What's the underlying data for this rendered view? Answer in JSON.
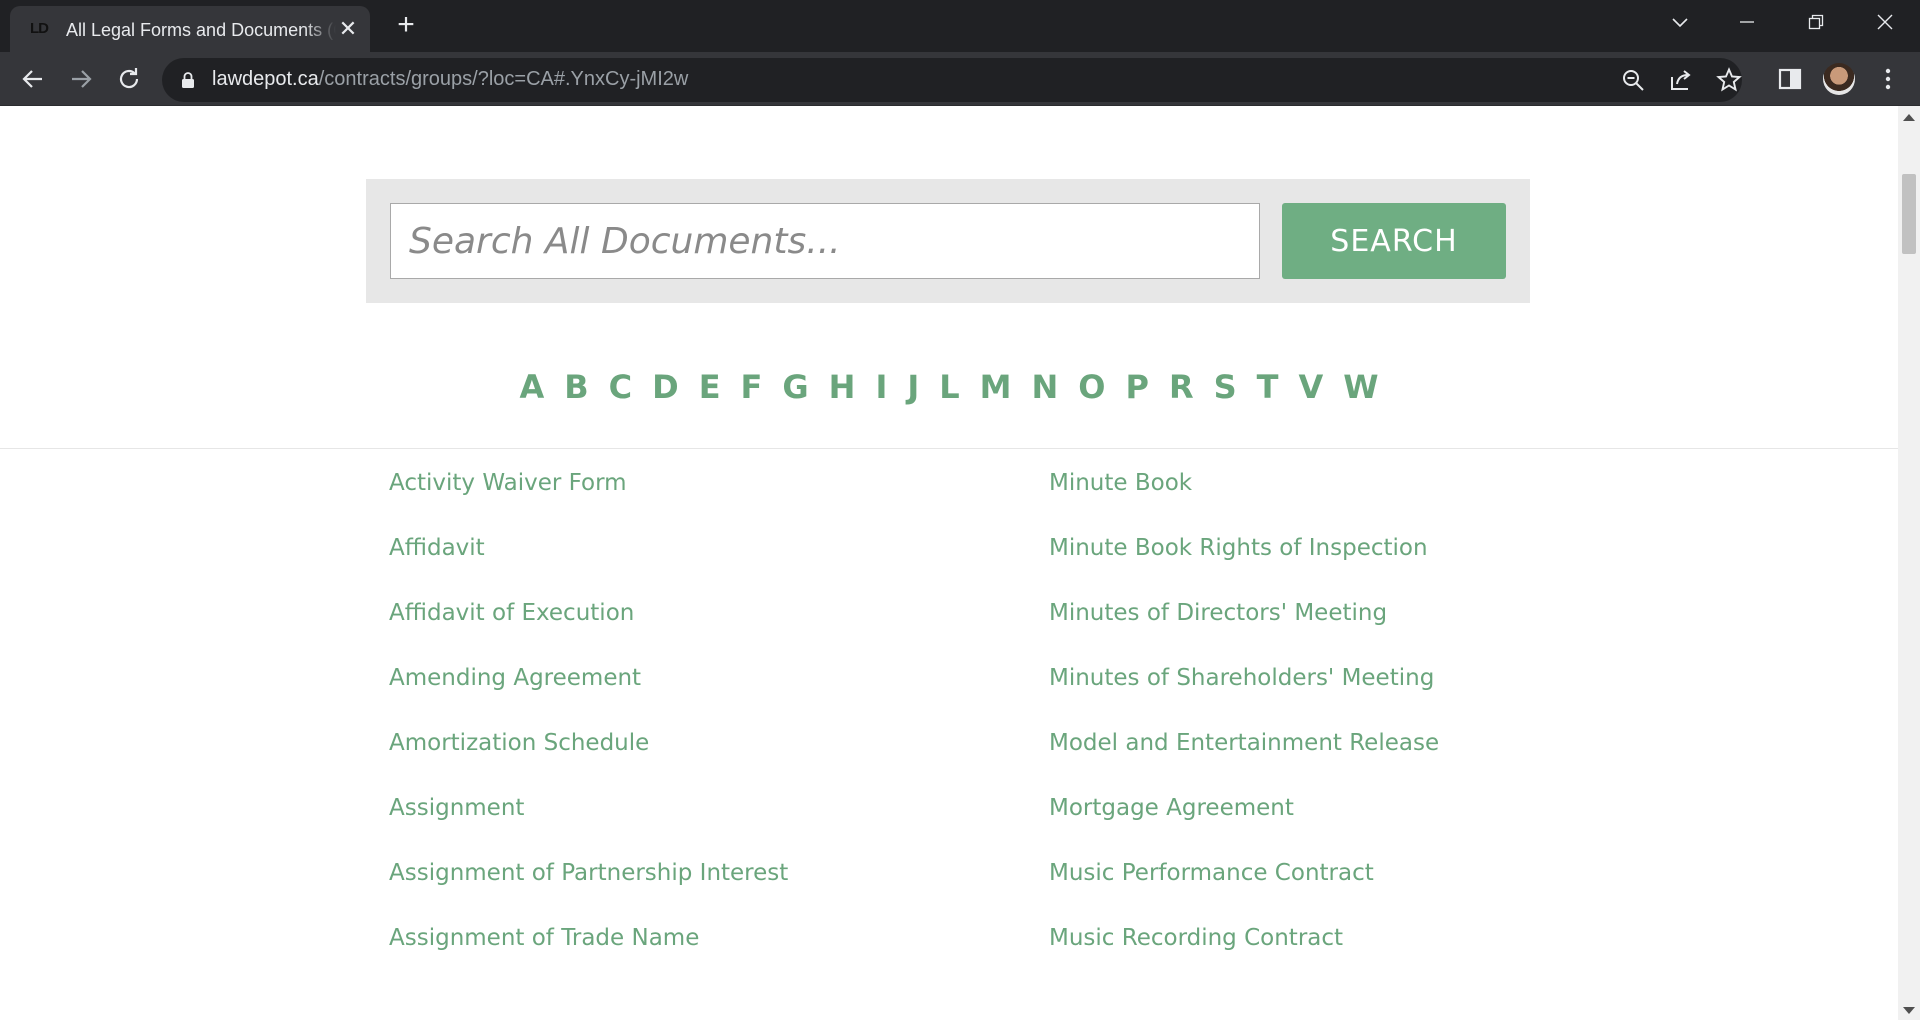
{
  "browser": {
    "tab_title": "All Legal Forms and Documents (Canada) | LawDepot",
    "favicon_text": "LD",
    "url_host": "lawdepot.ca",
    "url_path": "/contracts/groups/?loc=CA#.YnxCy-jMI2w",
    "tab_close_glyph": "✕",
    "new_tab_glyph": "+",
    "window_buttons": {
      "tab_list": "⌄",
      "minimize": "—",
      "restore": "❐",
      "close": "✕"
    }
  },
  "search": {
    "placeholder": "Search All Documents...",
    "button_label": "SEARCH"
  },
  "alphabet": [
    "A",
    "B",
    "C",
    "D",
    "E",
    "F",
    "G",
    "H",
    "I",
    "J",
    "L",
    "M",
    "N",
    "O",
    "P",
    "R",
    "S",
    "T",
    "V",
    "W"
  ],
  "documents": {
    "left": [
      "Activity Waiver Form",
      "Affidavit",
      "Affidavit of Execution",
      "Amending Agreement",
      "Amortization Schedule",
      "Assignment",
      "Assignment of Partnership Interest",
      "Assignment of Trade Name"
    ],
    "right": [
      "Minute Book",
      "Minute Book Rights of Inspection",
      "Minutes of Directors' Meeting",
      "Minutes of Shareholders' Meeting",
      "Model and Entertainment Release",
      "Mortgage Agreement",
      "Music Performance Contract",
      "Music Recording Contract"
    ]
  },
  "colors": {
    "accent_green": "#6aa57c",
    "button_green": "#6fae83",
    "chrome_dark": "#202124",
    "chrome_toolbar": "#35363a"
  }
}
